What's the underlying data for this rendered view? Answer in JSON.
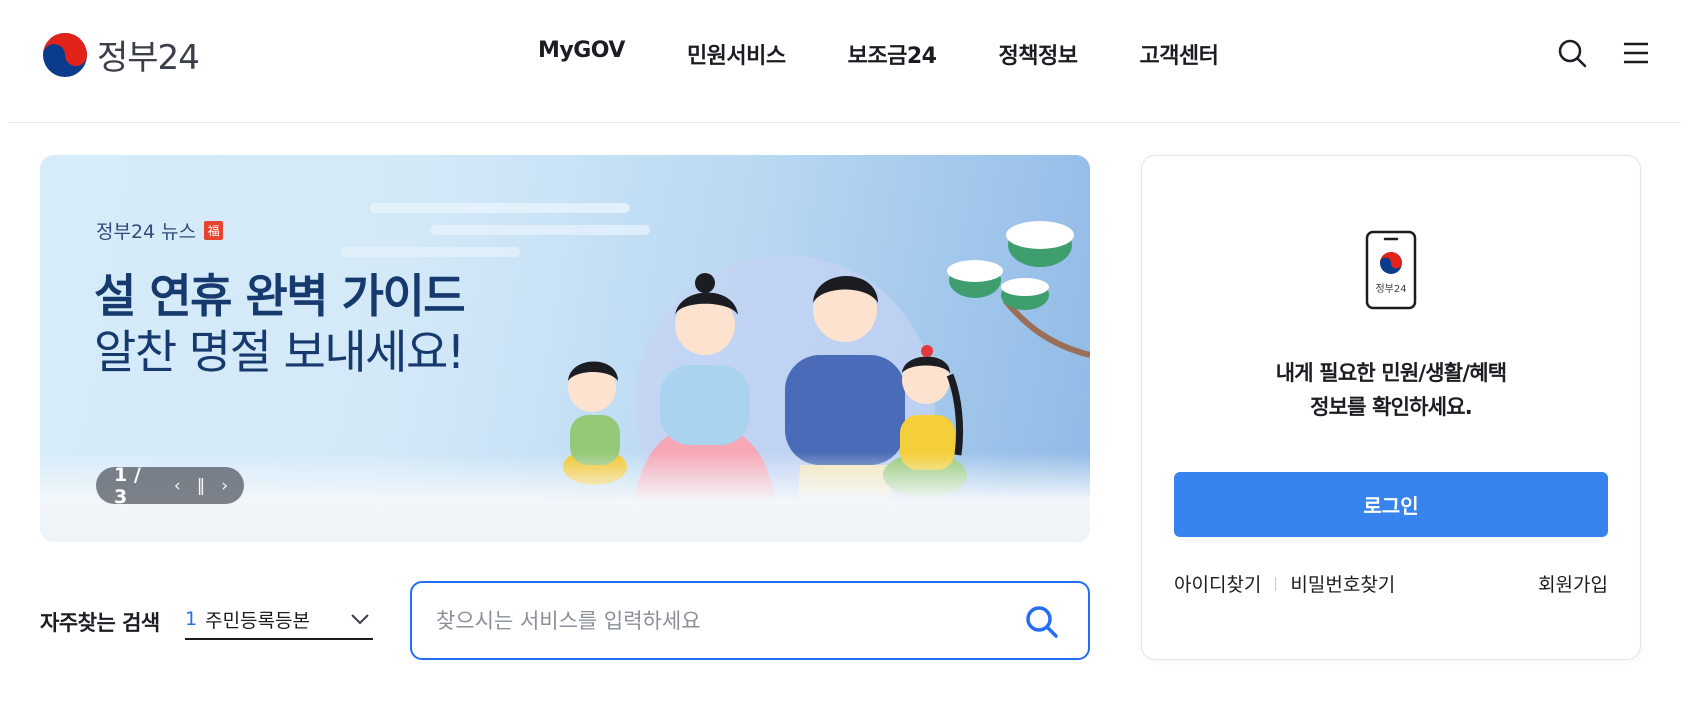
{
  "header": {
    "logo_text": "정부24",
    "nav": [
      "MyGOV",
      "민원서비스",
      "보조금24",
      "정책정보",
      "고객센터"
    ],
    "icons": [
      "search-icon",
      "menu-icon"
    ]
  },
  "banner": {
    "kicker": "정부24 뉴스",
    "kicker_badge": "福",
    "title_line1": "설 연휴 완벽 가이드",
    "title_line2": "알찬 명절 보내세요!",
    "pager": "1 / 3"
  },
  "search": {
    "freq_label": "자주찾는 검색",
    "freq_rank": "1",
    "freq_value": "주민등록등본",
    "placeholder": "찾으시는 서비스를 입력하세요"
  },
  "login": {
    "phone_label": "정부24",
    "message_line1": "내게 필요한 민원/생활/혜택",
    "message_line2": "정보를 확인하세요.",
    "button": "로그인",
    "find_id": "아이디찾기",
    "find_pw": "비밀번호찾기",
    "join": "회원가입"
  },
  "colors": {
    "accent": "#256ef4",
    "login_button": "#3784ee",
    "banner_title": "#173a6e"
  }
}
